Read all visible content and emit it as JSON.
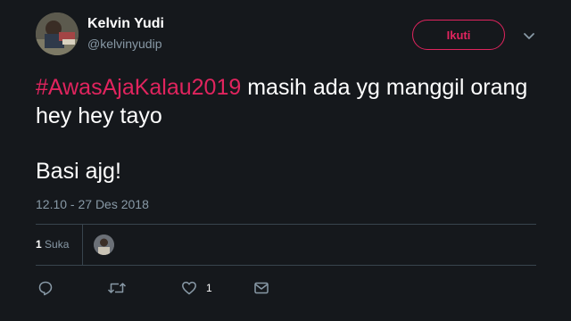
{
  "author": {
    "name": "Kelvin Yudi",
    "handle": "@kelvinyudip"
  },
  "follow_button": {
    "label": "Ikuti"
  },
  "tweet": {
    "hashtag": "#AwasAjaKalau2019",
    "line1_rest": " masih ada yg manggil orang hey hey tayo",
    "line2": "Basi ajg!"
  },
  "timestamp": "12.10 - 27 Des 2018",
  "likes": {
    "count": "1",
    "label": "Suka"
  },
  "actions": {
    "like_count": "1"
  },
  "colors": {
    "background": "#15181c",
    "accent": "#e0245e",
    "secondary_text": "#8899a6",
    "divider": "#38444d"
  },
  "icons": [
    "avatar",
    "chevron-down-icon",
    "reply-icon",
    "retweet-icon",
    "heart-icon",
    "mail-icon"
  ]
}
